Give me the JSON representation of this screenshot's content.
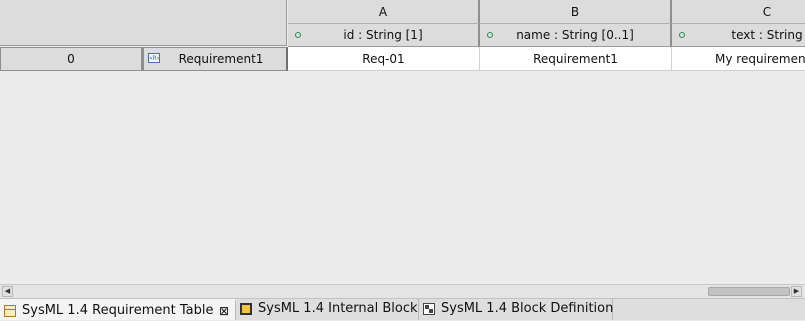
{
  "table": {
    "columns": [
      {
        "letter": "A",
        "header": "id : String [1]"
      },
      {
        "letter": "B",
        "header": "name : String [0..1]"
      },
      {
        "letter": "C",
        "header": "text : String"
      }
    ],
    "rows": [
      {
        "index": "0",
        "label": "Requirement1",
        "label_icon": "requirement-icon",
        "cells": [
          "Req-01",
          "Requirement1",
          "My requirement"
        ]
      }
    ]
  },
  "scrollbar": {
    "left_arrow": "◀",
    "right_arrow": "▶",
    "thumb_position": 0.9
  },
  "tabs": [
    {
      "label": "SysML 1.4 Requirement Table",
      "icon": "requirement-table-icon",
      "active": true,
      "close": "⊠"
    },
    {
      "label": "SysML 1.4 Internal Block",
      "icon": "internal-block-diagram-icon",
      "active": false
    },
    {
      "label": "SysML 1.4 Block Definition",
      "icon": "block-definition-diagram-icon",
      "active": false
    }
  ],
  "colors": {
    "header_bg": "#dcdcdc",
    "cell_bg": "#ffffff",
    "attribute_dot": "#2e8b57"
  }
}
